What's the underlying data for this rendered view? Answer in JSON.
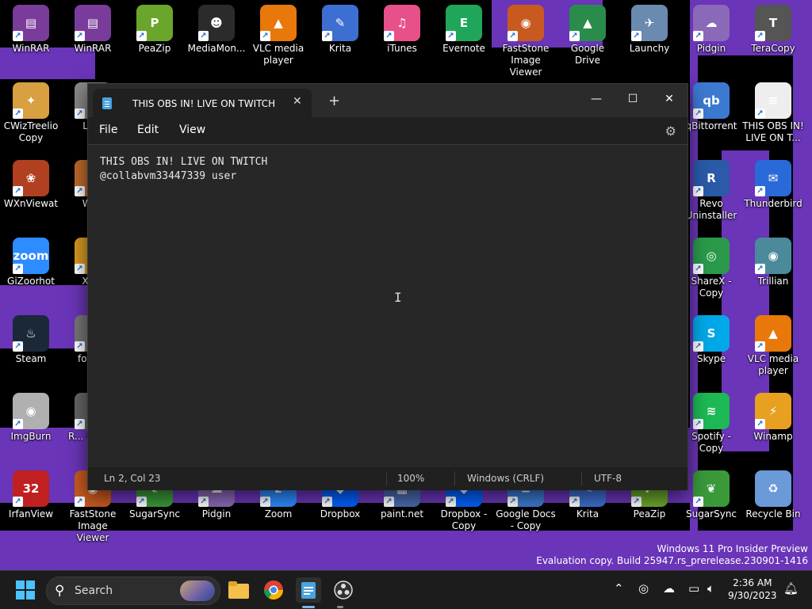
{
  "desktop": {
    "background_colors": {
      "base": "#000000",
      "accent": "#6a35b8"
    },
    "icons": [
      {
        "label": "WinRAR",
        "color": "#7a3c9a",
        "glyph": "▤"
      },
      {
        "label": "WinRAR",
        "color": "#7a3c9a",
        "glyph": "▤"
      },
      {
        "label": "PeaZip",
        "color": "#6aa62c",
        "glyph": "P"
      },
      {
        "label": "MediaMon...",
        "color": "#2b2b2b",
        "glyph": "☻"
      },
      {
        "label": "VLC media player",
        "color": "#e8780a",
        "glyph": "▲"
      },
      {
        "label": "Krita",
        "color": "#3c6fd1",
        "glyph": "✎"
      },
      {
        "label": "iTunes",
        "color": "#e8508a",
        "glyph": "♫"
      },
      {
        "label": "Evernote",
        "color": "#20a65a",
        "glyph": "E"
      },
      {
        "label": "FastStone Image Viewer",
        "color": "#c85a20",
        "glyph": "◉"
      },
      {
        "label": "Google Drive",
        "color": "#2a8c4a",
        "glyph": "▲"
      },
      {
        "label": "Launchy",
        "color": "#6a8ab0",
        "glyph": "✈"
      },
      {
        "label": "Pidgin",
        "color": "#8a6ab8",
        "glyph": "☁"
      },
      {
        "label": "TeraCopy",
        "color": "#555555",
        "glyph": "T"
      },
      {
        "label": "CWizTreelio Copy",
        "color": "#d8a040",
        "glyph": "✦"
      },
      {
        "label": "La...",
        "color": "#888888",
        "glyph": "▯"
      },
      {
        "label": "qBittorrent",
        "color": "#3c7ad1",
        "glyph": "qb"
      },
      {
        "label": "THIS OBS IN! LIVE ON T...",
        "color": "#eeeeee",
        "glyph": "≡"
      },
      {
        "label": "WXnViewat",
        "color": "#b04020",
        "glyph": "❀"
      },
      {
        "label": "Wi...",
        "color": "#c06a2a",
        "glyph": "▤"
      },
      {
        "label": "Revo Uninstaller",
        "color": "#2a5aa8",
        "glyph": "R"
      },
      {
        "label": "Thunderbird",
        "color": "#2a6ad8",
        "glyph": "✉"
      },
      {
        "label": "GiZoorhot",
        "color": "#2d8cff",
        "glyph": "zoom"
      },
      {
        "label": "Xn...",
        "color": "#d89a20",
        "glyph": "✶"
      },
      {
        "label": "ShareX - Copy",
        "color": "#2a9a4a",
        "glyph": "◎"
      },
      {
        "label": "Trillian",
        "color": "#4a8a9a",
        "glyph": "◉"
      },
      {
        "label": "Steam",
        "color": "#1b2838",
        "glyph": "♨"
      },
      {
        "label": "foob...",
        "color": "#777777",
        "glyph": "◐"
      },
      {
        "label": "Skype",
        "color": "#00a8e8",
        "glyph": "S"
      },
      {
        "label": "VLC media player",
        "color": "#e8780a",
        "glyph": "▲"
      },
      {
        "label": "ImgBurn",
        "color": "#b0b0b0",
        "glyph": "◉"
      },
      {
        "label": "R... Unin...",
        "color": "#666666",
        "glyph": "▯"
      },
      {
        "label": "Spotify - Copy",
        "color": "#1db954",
        "glyph": "≋"
      },
      {
        "label": "Winamp",
        "color": "#e8a020",
        "glyph": "⚡"
      },
      {
        "label": "IrfanView",
        "color": "#c02020",
        "glyph": "32"
      },
      {
        "label": "FastStone Image Viewer",
        "color": "#c85a20",
        "glyph": "◉"
      },
      {
        "label": "SugarSync",
        "color": "#3a9a3a",
        "glyph": "❦"
      },
      {
        "label": "Pidgin",
        "color": "#8a6ab8",
        "glyph": "☁"
      },
      {
        "label": "Zoom",
        "color": "#2d8cff",
        "glyph": "z"
      },
      {
        "label": "Dropbox",
        "color": "#0061fe",
        "glyph": "◆"
      },
      {
        "label": "paint.net",
        "color": "#4a6ab0",
        "glyph": "▦"
      },
      {
        "label": "Dropbox - Copy",
        "color": "#0061fe",
        "glyph": "◆"
      },
      {
        "label": "Google Docs - Copy",
        "color": "#3c7ad1",
        "glyph": "≡"
      },
      {
        "label": "Krita",
        "color": "#3c6fd1",
        "glyph": "✎"
      },
      {
        "label": "PeaZip",
        "color": "#6aa62c",
        "glyph": "P"
      },
      {
        "label": "SugarSync",
        "color": "#3a9a3a",
        "glyph": "❦"
      },
      {
        "label": "Recycle Bin",
        "color": "#6a9ad8",
        "glyph": "♻"
      }
    ],
    "watermark": {
      "line1": "Windows 11 Pro Insider Preview",
      "line2": "Evaluation copy. Build 25947.rs_prerelease.230901-1416"
    }
  },
  "notepad": {
    "tab_title": "THIS OBS IN! LIVE ON TWITCH",
    "tab_close": "✕",
    "new_tab": "+",
    "window_controls": {
      "minimize": "—",
      "maximize": "☐",
      "close": "✕"
    },
    "menu": {
      "file": "File",
      "edit": "Edit",
      "view": "View"
    },
    "settings_icon": "⚙",
    "content": {
      "line1": "THIS OBS IN! LIVE ON TWITCH",
      "line2": "@collabvm33447339 user"
    },
    "status": {
      "position": "Ln 2, Col 23",
      "zoom": "100%",
      "line_ending": "Windows (CRLF)",
      "encoding": "UTF-8"
    }
  },
  "taskbar": {
    "search_placeholder": "Search",
    "apps": [
      {
        "name": "start-button",
        "glyph": "⊞"
      },
      {
        "name": "file-explorer-icon",
        "glyph": "📁"
      },
      {
        "name": "chrome-icon",
        "glyph": "◉"
      },
      {
        "name": "notepad-icon",
        "glyph": "▤"
      },
      {
        "name": "obs-icon",
        "glyph": "◍"
      }
    ],
    "tray": {
      "chevron": "⌃",
      "time": "2:36 AM",
      "date": "9/30/2023"
    }
  }
}
